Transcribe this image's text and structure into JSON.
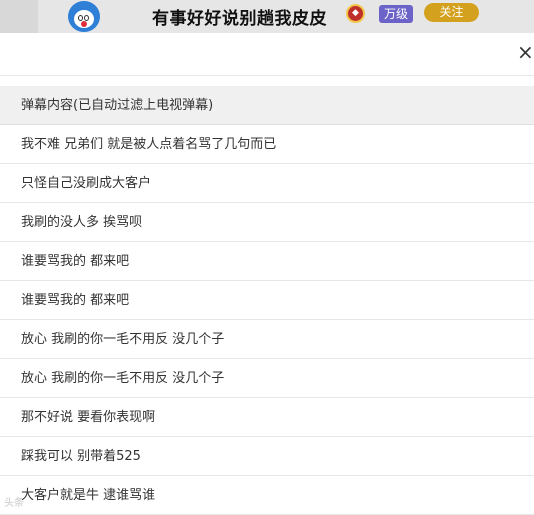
{
  "header": {
    "room_title": "有事好好说别趟我皮皮",
    "level_label": "万级",
    "follow_label": "关注"
  },
  "dialog": {
    "close_label": "×",
    "list_title": "弹幕内容(已自动过滤上电视弹幕)",
    "messages": [
      "我不难 兄弟们 就是被人点着名骂了几句而已",
      "只怪自己没刷成大客户",
      "我刷的没人多 挨骂呗",
      "谁要骂我的 都来吧",
      "谁要骂我的 都来吧",
      "放心 我刷的你一毛不用反 没几个子",
      "放心 我刷的你一毛不用反 没几个子",
      "那不好说 要看你表现啊",
      "踩我可以 别带着525",
      "大客户就是牛 逮谁骂谁"
    ]
  },
  "watermark": "头条"
}
